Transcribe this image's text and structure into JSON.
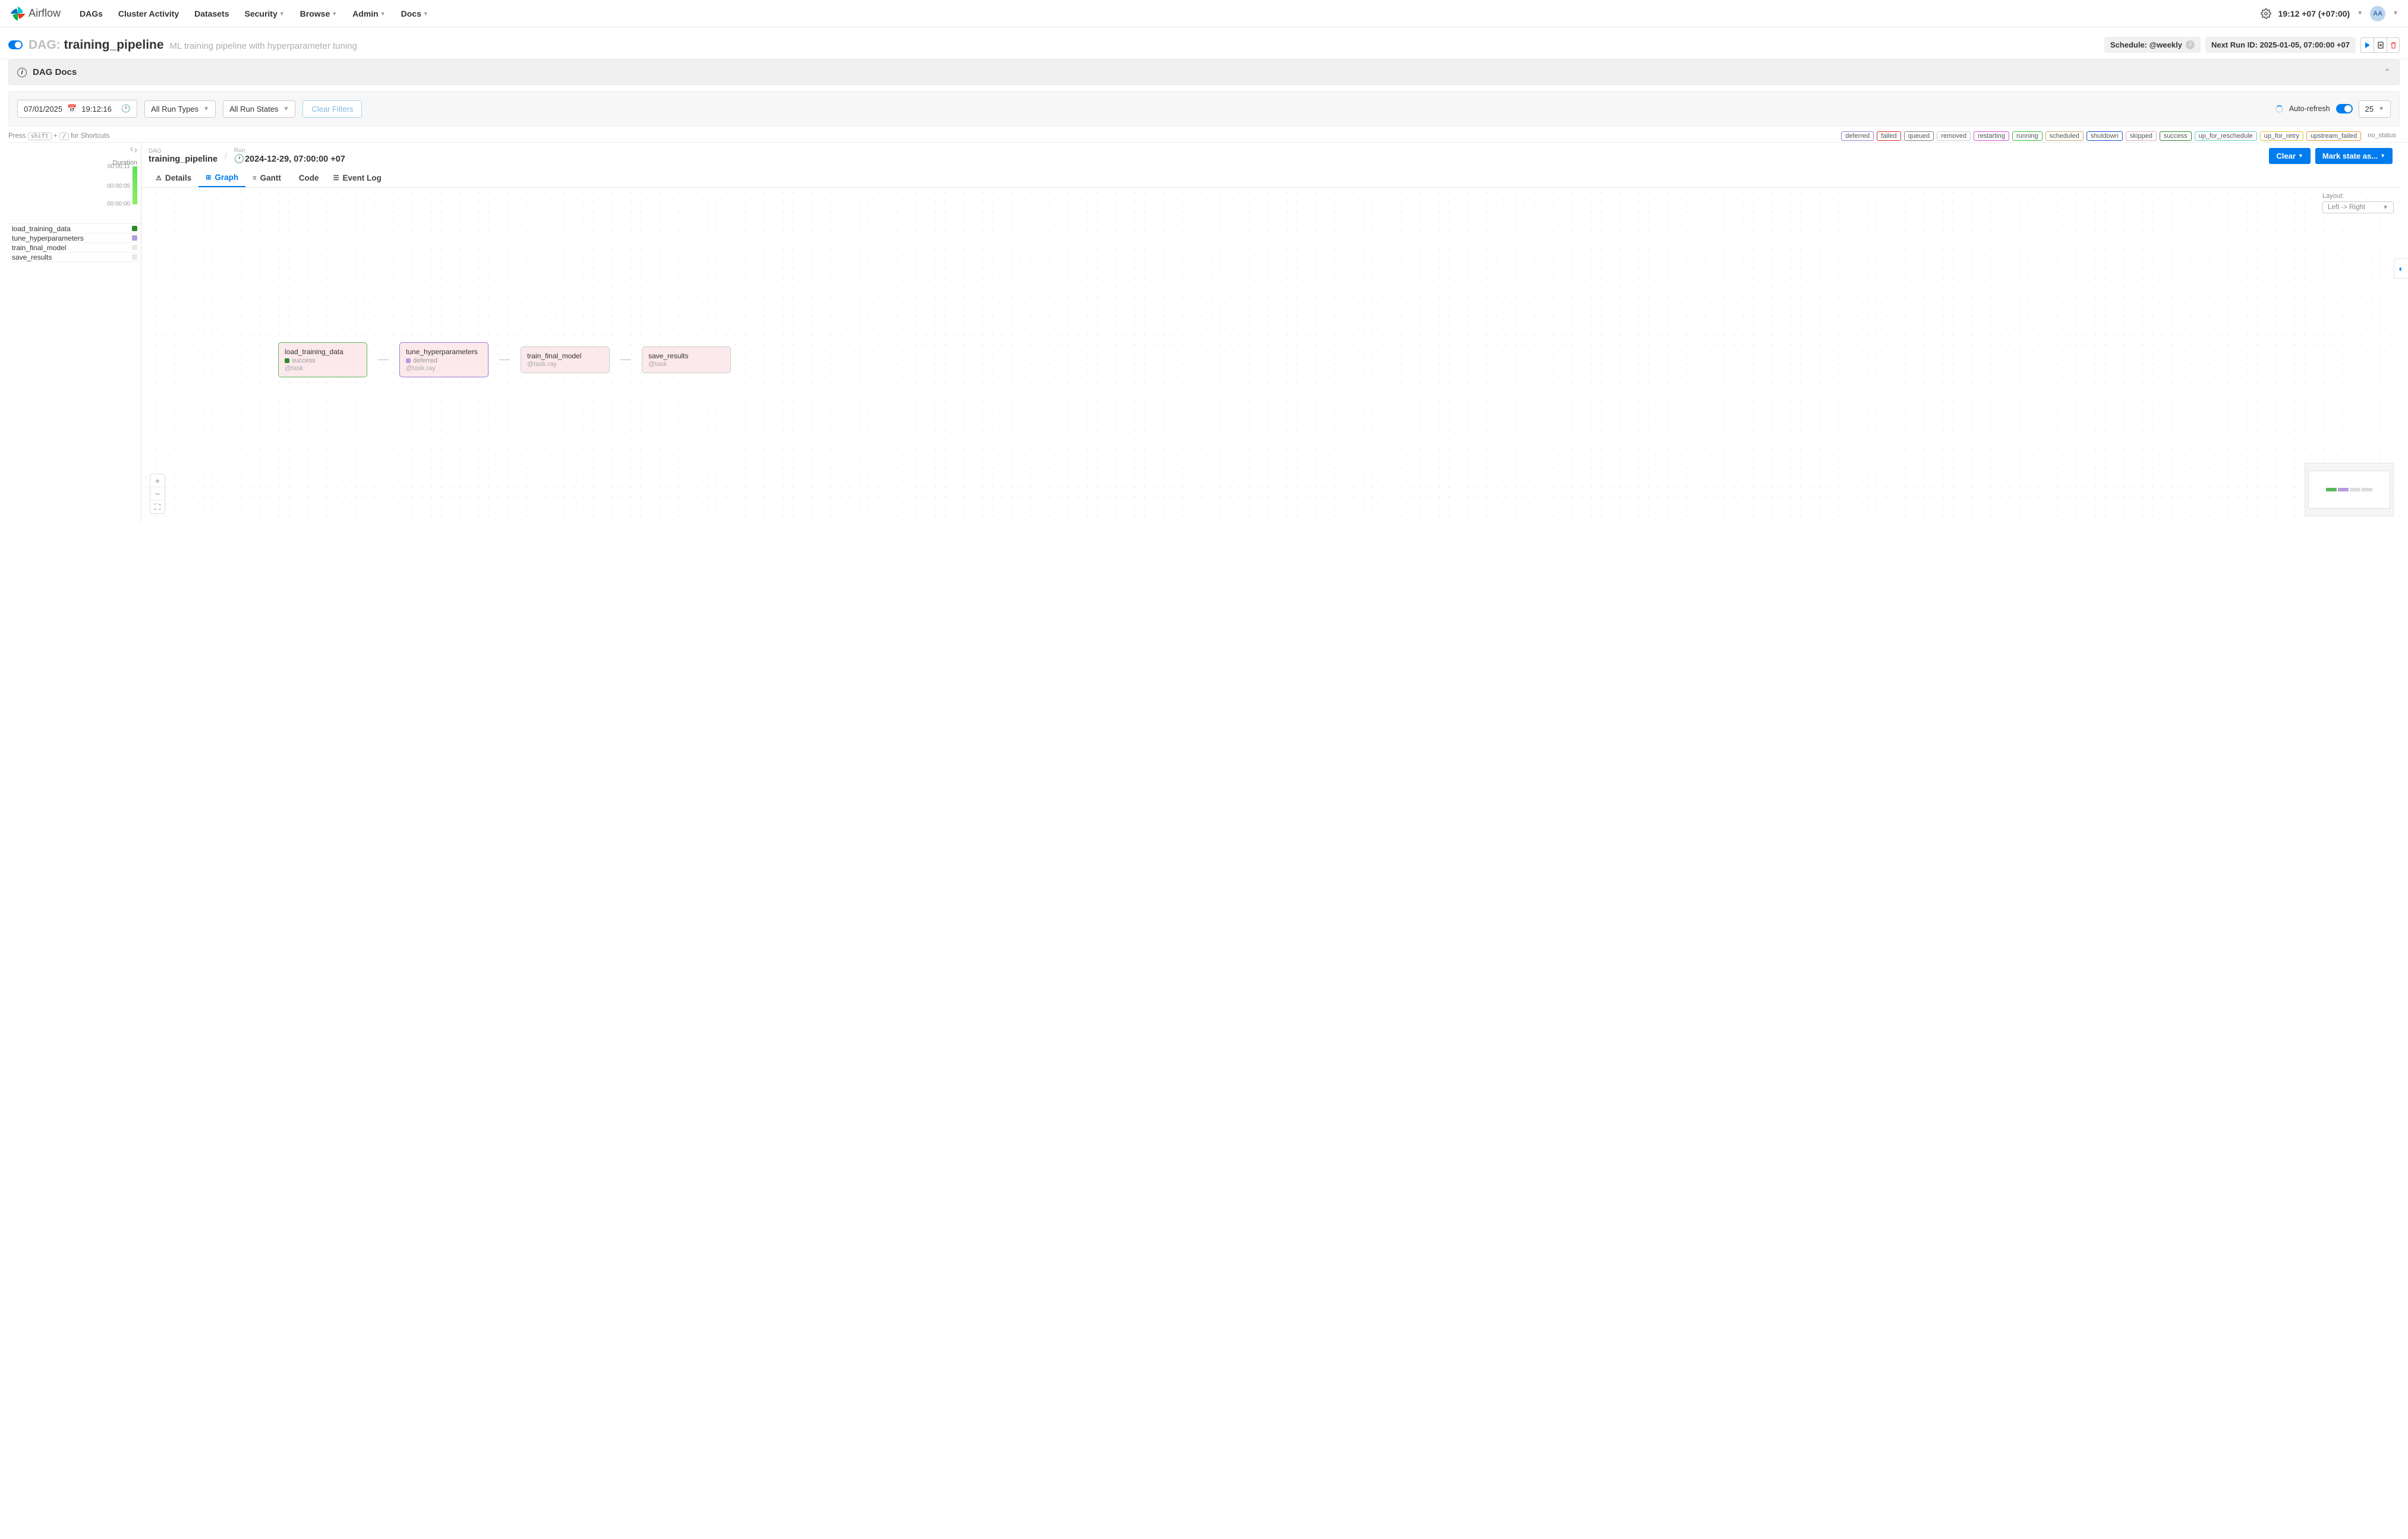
{
  "brand": "Airflow",
  "nav": [
    "DAGs",
    "Cluster Activity",
    "Datasets",
    "Security",
    "Browse",
    "Admin",
    "Docs"
  ],
  "nav_has_dropdown": [
    false,
    false,
    false,
    true,
    true,
    true,
    true
  ],
  "clock": "19:12 +07 (+07:00)",
  "avatar_initials": "AA",
  "dag": {
    "prefix": "DAG:",
    "name": "training_pipeline",
    "desc": "ML training pipeline with hyperparameter tuning",
    "schedule_label": "Schedule: @weekly",
    "next_run_label": "Next Run ID: 2025-01-05, 07:00:00 +07"
  },
  "docs_title": "DAG Docs",
  "filter": {
    "date": "07/01/2025",
    "time": "19:12:16",
    "run_types": "All Run Types",
    "run_states": "All Run States",
    "clear": "Clear Filters",
    "auto_refresh": "Auto-refresh",
    "count": "25"
  },
  "shortcut_hint_a": "Press",
  "shortcut_key1": "shift",
  "shortcut_plus": "+",
  "shortcut_key2": "/",
  "shortcut_hint_b": "for Shortcuts",
  "status_legend": [
    {
      "label": "deferred",
      "color": "#9c7bd9"
    },
    {
      "label": "failed",
      "color": "#e02d2d"
    },
    {
      "label": "queued",
      "color": "#808080"
    },
    {
      "label": "removed",
      "color": "#cccccc"
    },
    {
      "label": "restarting",
      "color": "#d651d6"
    },
    {
      "label": "running",
      "color": "#34c134"
    },
    {
      "label": "scheduled",
      "color": "#c9a96e"
    },
    {
      "label": "shutdown",
      "color": "#1f4fd1"
    },
    {
      "label": "skipped",
      "color": "#e8a8c3"
    },
    {
      "label": "success",
      "color": "#2e8b2e"
    },
    {
      "label": "up_for_reschedule",
      "color": "#5fcfc0"
    },
    {
      "label": "up_for_retry",
      "color": "#e6c23c"
    },
    {
      "label": "upstream_failed",
      "color": "#e89c2c"
    },
    {
      "label": "no_status",
      "color": "#888888"
    }
  ],
  "tree": {
    "duration_label": "Duration",
    "ticks": [
      "00:00:11",
      "00:00:05",
      "00:00:00"
    ],
    "tasks": [
      {
        "name": "load_training_data",
        "color": "#2e8b2e"
      },
      {
        "name": "tune_hyperparameters",
        "color": "#b49ce0"
      },
      {
        "name": "train_final_model",
        "color": "#e8e8e8"
      },
      {
        "name": "save_results",
        "color": "#e8e8e8"
      }
    ]
  },
  "breadcrumb": {
    "dag_lbl": "DAG",
    "dag_val": "training_pipeline",
    "run_lbl": "Run",
    "run_val": "2024-12-29, 07:00:00 +07"
  },
  "actions": {
    "clear": "Clear",
    "mark": "Mark state as..."
  },
  "tabs": [
    "Details",
    "Graph",
    "Gantt",
    "Code",
    "Event Log"
  ],
  "layout": {
    "label": "Layout:",
    "value": "Left -> Right"
  },
  "nodes": [
    {
      "title": "load_training_data",
      "state": "success",
      "state_color": "#2e8b2e",
      "op": "@task",
      "cls": "success"
    },
    {
      "title": "tune_hyperparameters",
      "state": "deferred",
      "state_color": "#b49ce0",
      "op": "@task.ray",
      "cls": "deferred"
    },
    {
      "title": "train_final_model",
      "state": "",
      "state_color": "",
      "op": "@task.ray",
      "cls": ""
    },
    {
      "title": "save_results",
      "state": "",
      "state_color": "",
      "op": "@task",
      "cls": ""
    }
  ],
  "minimap_colors": [
    "#5cb85c",
    "#b49ce0",
    "#ddd",
    "#ddd"
  ]
}
